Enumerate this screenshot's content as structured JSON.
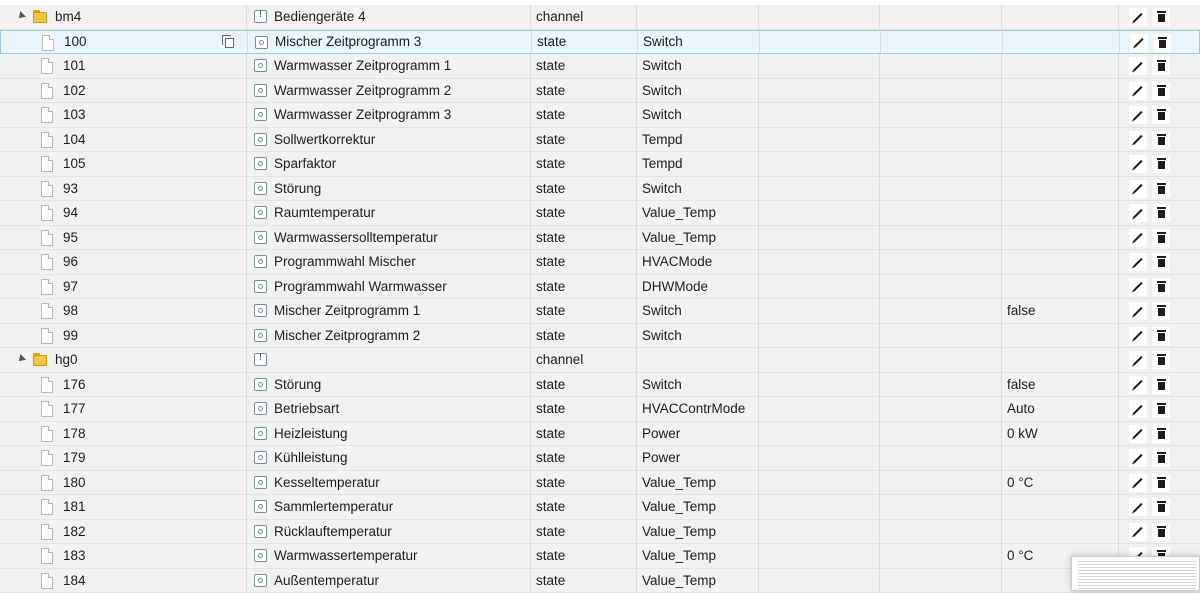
{
  "rows": [
    {
      "kind": "folder",
      "id": "bm4",
      "name": "Bediengeräte 4",
      "type": "channel",
      "role": "",
      "value": "",
      "name_icon": "channel"
    },
    {
      "kind": "state",
      "id": "100",
      "name": "Mischer Zeitprogramm 3",
      "type": "state",
      "role": "Switch",
      "value": "",
      "selected": true
    },
    {
      "kind": "state",
      "id": "101",
      "name": "Warmwasser Zeitprogramm 1",
      "type": "state",
      "role": "Switch",
      "value": ""
    },
    {
      "kind": "state",
      "id": "102",
      "name": "Warmwasser Zeitprogramm 2",
      "type": "state",
      "role": "Switch",
      "value": ""
    },
    {
      "kind": "state",
      "id": "103",
      "name": "Warmwasser Zeitprogramm 3",
      "type": "state",
      "role": "Switch",
      "value": ""
    },
    {
      "kind": "state",
      "id": "104",
      "name": "Sollwertkorrektur",
      "type": "state",
      "role": "Tempd",
      "value": ""
    },
    {
      "kind": "state",
      "id": "105",
      "name": "Sparfaktor",
      "type": "state",
      "role": "Tempd",
      "value": ""
    },
    {
      "kind": "state",
      "id": "93",
      "name": "Störung",
      "type": "state",
      "role": "Switch",
      "value": ""
    },
    {
      "kind": "state",
      "id": "94",
      "name": "Raumtemperatur",
      "type": "state",
      "role": "Value_Temp",
      "value": ""
    },
    {
      "kind": "state",
      "id": "95",
      "name": "Warmwassersolltemperatur",
      "type": "state",
      "role": "Value_Temp",
      "value": ""
    },
    {
      "kind": "state",
      "id": "96",
      "name": "Programmwahl Mischer",
      "type": "state",
      "role": "HVACMode",
      "value": ""
    },
    {
      "kind": "state",
      "id": "97",
      "name": "Programmwahl Warmwasser",
      "type": "state",
      "role": "DHWMode",
      "value": ""
    },
    {
      "kind": "state",
      "id": "98",
      "name": "Mischer Zeitprogramm 1",
      "type": "state",
      "role": "Switch",
      "value": "false"
    },
    {
      "kind": "state",
      "id": "99",
      "name": "Mischer Zeitprogramm 2",
      "type": "state",
      "role": "Switch",
      "value": ""
    },
    {
      "kind": "folder",
      "id": "hg0",
      "name": "",
      "type": "channel",
      "role": "",
      "value": "",
      "name_icon": "channel"
    },
    {
      "kind": "state",
      "id": "176",
      "name": "Störung",
      "type": "state",
      "role": "Switch",
      "value": "false"
    },
    {
      "kind": "state",
      "id": "177",
      "name": "Betriebsart",
      "type": "state",
      "role": "HVACContrMode",
      "value": "Auto"
    },
    {
      "kind": "state",
      "id": "178",
      "name": "Heizleistung",
      "type": "state",
      "role": "Power",
      "value": "0 kW"
    },
    {
      "kind": "state",
      "id": "179",
      "name": "Kühlleistung",
      "type": "state",
      "role": "Power",
      "value": ""
    },
    {
      "kind": "state",
      "id": "180",
      "name": "Kesseltemperatur",
      "type": "state",
      "role": "Value_Temp",
      "value": "0 °C"
    },
    {
      "kind": "state",
      "id": "181",
      "name": "Sammlertemperatur",
      "type": "state",
      "role": "Value_Temp",
      "value": ""
    },
    {
      "kind": "state",
      "id": "182",
      "name": "Rücklauftemperatur",
      "type": "state",
      "role": "Value_Temp",
      "value": ""
    },
    {
      "kind": "state",
      "id": "183",
      "name": "Warmwassertemperatur",
      "type": "state",
      "role": "Value_Temp",
      "value": "0 °C"
    },
    {
      "kind": "state",
      "id": "184",
      "name": "Außentemperatur",
      "type": "state",
      "role": "Value_Temp",
      "value": ""
    }
  ],
  "icons": {
    "expand": "caret-down-icon",
    "folder": "folder-icon",
    "file": "file-icon",
    "copy": "copy-icon",
    "state": "state-icon",
    "channel": "channel-icon",
    "edit": "pencil-icon",
    "delete": "trash-icon"
  }
}
